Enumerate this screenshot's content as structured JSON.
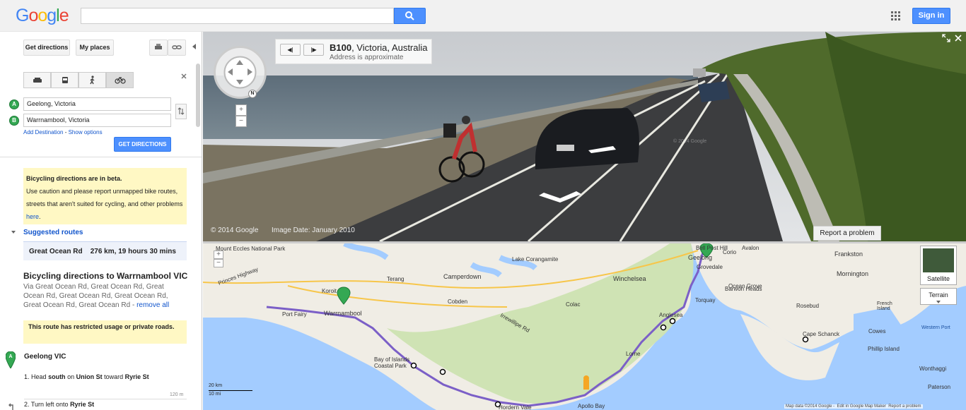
{
  "header": {
    "logo_letters": [
      "G",
      "o",
      "o",
      "g",
      "l",
      "e"
    ],
    "logo_colors": [
      "#4285f4",
      "#ea4335",
      "#fbbc05",
      "#4285f4",
      "#34a853",
      "#ea4335"
    ],
    "search_value": "",
    "signin_label": "Sign in"
  },
  "sidebar": {
    "get_directions_tab": "Get directions",
    "my_places_tab": "My places",
    "modes": [
      "car",
      "transit",
      "walking",
      "bicycling"
    ],
    "selected_mode": "bicycling",
    "from_marker": "A",
    "from_value": "Geelong, Victoria",
    "to_marker": "B",
    "to_value": "Warrnambool, Victoria",
    "add_destination": "Add Destination",
    "separator": " - ",
    "show_options": "Show options",
    "get_directions_button": "GET DIRECTIONS",
    "beta_title": "Bicycling directions are in beta.",
    "beta_body": "Use caution and please report unmapped bike routes, streets that aren't suited for cycling, and other problems ",
    "beta_link": "here",
    "beta_end": ".",
    "suggested_routes": "Suggested routes",
    "route_name": "Great Ocean Rd",
    "route_stats": "276 km, 19 hours 30 mins",
    "directions_title": "Bicycling directions to Warrnambool VIC",
    "via_text": "Via Great Ocean Rd, Great Ocean Rd, Great Ocean Rd, Great Ocean Rd, Great Ocean Rd, Great Ocean Rd, Great Ocean Rd - ",
    "remove_all": "remove all",
    "restricted_notice": "This route has restricted usage or private roads.",
    "start_marker": "A",
    "start_name": "Geelong VIC",
    "step1_num": "1.",
    "step1_prefix": "Head ",
    "step1_dir": "south",
    "step1_mid": " on ",
    "step1_street": "Union St",
    "step1_toward": " toward ",
    "step1_dest": "Ryrie St",
    "step1_dist": "120 m",
    "step2_num": "2.",
    "step2_prefix": "Turn left onto ",
    "step2_street": "Ryrie St"
  },
  "streetview": {
    "road": "B100",
    "place": ", Victoria, Australia",
    "approx": "Address is approximate",
    "copyright": "© 2014 Google",
    "image_date": "Image Date: January 2010",
    "watermark": "© 2014 Google",
    "report": "Report a problem",
    "zoom_in": "+",
    "zoom_out": "−",
    "compass_n": "N"
  },
  "map": {
    "labels": [
      "Mount Eccles National Park",
      "Lake Corangamite",
      "Camperdown",
      "Terang",
      "Winchelsea",
      "Princes Highway",
      "Koroit",
      "Port Fairy",
      "Warrnambool",
      "Cobden",
      "Colac",
      "Irrewillipe Rd",
      "Anglesea",
      "Lorne",
      "Bay of Islands Coastal Park",
      "Apollo Bay",
      "Geelong",
      "Grovedale",
      "Torquay",
      "Ocean Grove",
      "Frankston",
      "Mornington",
      "Rosebud",
      "Cape Schanck",
      "Cowes",
      "Phillip Island",
      "French Island",
      "Wonthaggi",
      "Paterson",
      "Western Port",
      "Hordern Vale",
      "Barwon Heads",
      "Bell Post Hill",
      "Corio",
      "Avalon"
    ],
    "satellite": "Satellite",
    "terrain": "Terrain",
    "scale_km": "20 km",
    "scale_mi": "10 mi",
    "footer": "Map data ©2014 Google -",
    "edit": "Edit in Google Map Maker",
    "report": "Report a problem",
    "route_color": "#7b5fc7"
  }
}
